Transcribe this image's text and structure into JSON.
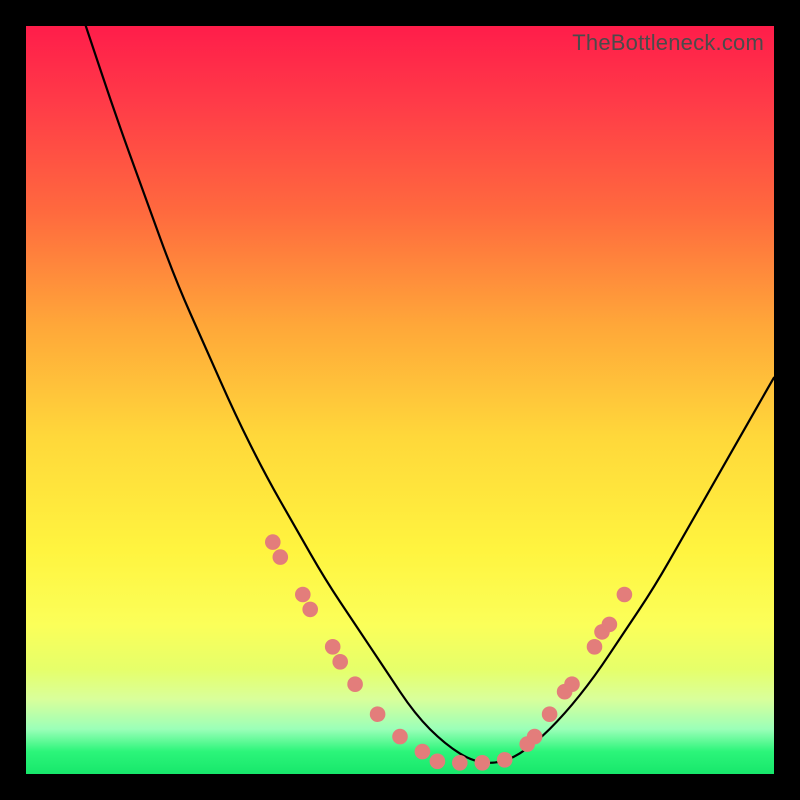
{
  "watermark": "TheBottleneck.com",
  "colors": {
    "point_fill": "#e37d7b",
    "curve_stroke": "#000000",
    "gradient_top": "#ff1d4a",
    "gradient_mid": "#fff43f",
    "gradient_bottom": "#17e76b"
  },
  "chart_data": {
    "type": "line",
    "title": "",
    "xlabel": "",
    "ylabel": "",
    "xlim": [
      0,
      100
    ],
    "ylim": [
      0,
      100
    ],
    "grid": false,
    "notes": "V-shaped bottleneck curve over a red-to-green heat gradient. Curve values are percentage heights (0 at bottom/green, 100 at top/red). Scatter points highlight the lower region of the curve (salmon markers).",
    "series": [
      {
        "name": "bottleneck-curve",
        "x": [
          8,
          12,
          16,
          20,
          24,
          28,
          32,
          36,
          40,
          44,
          48,
          52,
          56,
          60,
          64,
          68,
          72,
          76,
          80,
          84,
          88,
          92,
          96,
          100
        ],
        "values": [
          100,
          88,
          77,
          66,
          57,
          48,
          40,
          33,
          26,
          20,
          14,
          8,
          4,
          1.5,
          1.5,
          4,
          8,
          13,
          19,
          25,
          32,
          39,
          46,
          53
        ]
      }
    ],
    "scatter": [
      {
        "name": "highlighted-points-left",
        "x": [
          33,
          34,
          37,
          38,
          41,
          42,
          44,
          47,
          50,
          53
        ],
        "values": [
          31,
          29,
          24,
          22,
          17,
          15,
          12,
          8,
          5,
          3
        ]
      },
      {
        "name": "highlighted-points-bottom",
        "x": [
          55,
          58,
          61,
          64
        ],
        "values": [
          1.7,
          1.5,
          1.5,
          1.9
        ]
      },
      {
        "name": "highlighted-points-right",
        "x": [
          67,
          68,
          70,
          72,
          73,
          76,
          77,
          78,
          80
        ],
        "values": [
          4,
          5,
          8,
          11,
          12,
          17,
          19,
          20,
          24
        ]
      }
    ]
  }
}
